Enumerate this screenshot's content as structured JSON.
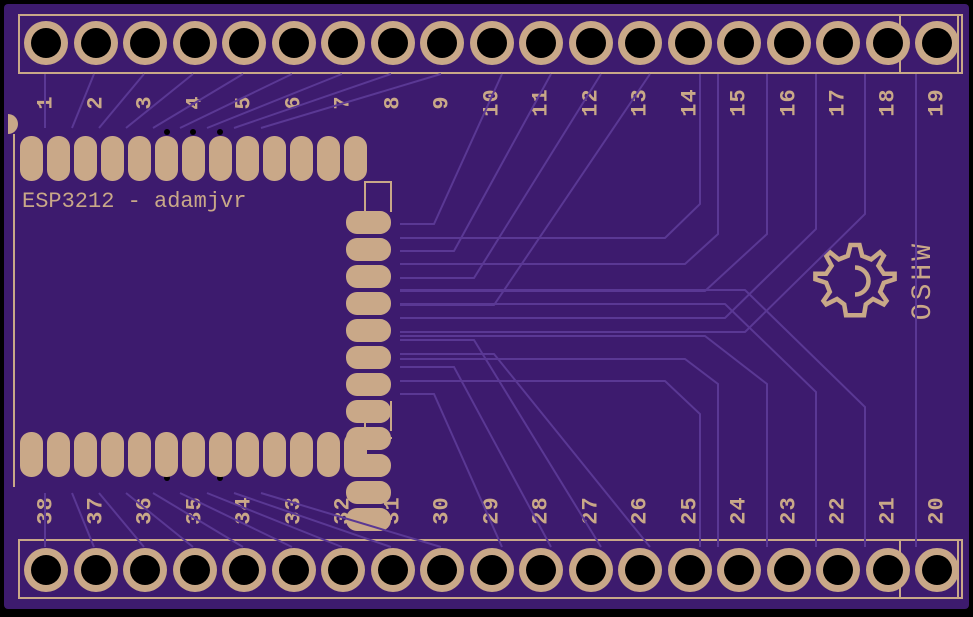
{
  "board_text": "ESP3212 - adamjvr",
  "oshw_label": "OSHW",
  "pins_top": [
    "1",
    "2",
    "3",
    "4",
    "5",
    "6",
    "7",
    "8",
    "9",
    "10",
    "11",
    "12",
    "13",
    "14",
    "15",
    "16",
    "17",
    "18",
    "19"
  ],
  "pins_bottom": [
    "38",
    "37",
    "36",
    "35",
    "34",
    "33",
    "32",
    "31",
    "30",
    "29",
    "28",
    "27",
    "26",
    "25",
    "24",
    "23",
    "22",
    "21",
    "20"
  ],
  "top_smd_pad_count": 13,
  "bottom_smd_pad_count": 13,
  "center_smd_pad_count": 12
}
